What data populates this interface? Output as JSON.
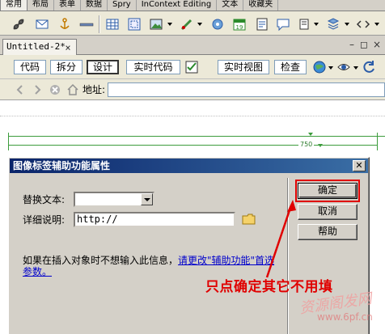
{
  "insert_tabs": [
    "常用",
    "布局",
    "表单",
    "数据",
    "Spry",
    "InContext Editing",
    "文本",
    "收藏夹"
  ],
  "insert_icons": [
    "hyperlink-icon",
    "email-link-icon",
    "named-anchor-icon",
    "horizontal-rule-icon",
    "table-icon",
    "insert-div-icon",
    "image-icon",
    "media-icon",
    "date-icon",
    "server-include-icon",
    "comment-icon",
    "head-icon",
    "script-icon",
    "template-icon",
    "tag-chooser-icon"
  ],
  "document": {
    "tab_label": "Untitled-2*",
    "close_symbol": "×",
    "minimize_symbol": "–",
    "restore_symbol": "◻",
    "window_close_symbol": "×"
  },
  "view_buttons": {
    "code": "代码",
    "split": "拆分",
    "design": "设计",
    "live_code": "实时代码",
    "live_view": "实时视图",
    "inspect": "检查"
  },
  "address": {
    "label": "地址:",
    "value": ""
  },
  "canvas": {
    "width_label": "750"
  },
  "dialog": {
    "title": "图像标签辅助功能属性",
    "close_symbol": "✕",
    "alt_label": "替换文本:",
    "alt_value": "",
    "longdesc_label": "详细说明:",
    "longdesc_value": "http://",
    "info_text": "如果在插入对象时不想输入此信息，",
    "info_link": "请更改\"辅助功能\"首选参数。",
    "ok_label": "确定",
    "cancel_label": "取消",
    "help_label": "帮助"
  },
  "annotation": {
    "text": "只点确定其它不用填",
    "color": "#e00000"
  },
  "watermark": {
    "cn": "资源阁发网",
    "url": "www.6pf.cn"
  }
}
